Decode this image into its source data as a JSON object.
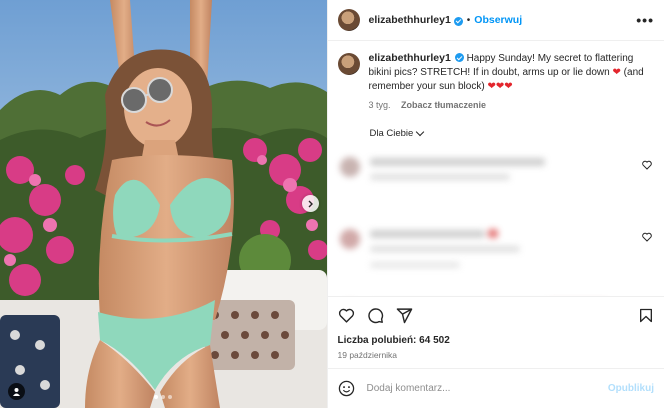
{
  "header": {
    "username": "elizabethhurley1",
    "separator": "•",
    "follow_label": "Obserwuj",
    "more_label": "•••"
  },
  "caption": {
    "username": "elizabethhurley1",
    "text": "Happy Sunday! My secret to flattering bikini pics? STRETCH! If in doubt, arms up or lie down",
    "text_tail": "(and remember your sun block)",
    "heart_single": "❤",
    "hearts": "❤❤❤",
    "age": "3 tyg.",
    "translate_label": "Zobacz tłumaczenie"
  },
  "comments_filter": {
    "label": "Dla Ciebie"
  },
  "engagement": {
    "likes_text": "Liczba polubień: 64 502",
    "date": "19 października"
  },
  "composer": {
    "placeholder": "Dodaj komentarz...",
    "post_label": "Opublikuj"
  },
  "carousel": {
    "slides": 3,
    "active_index": 0
  },
  "colors": {
    "accent": "#0095f6",
    "verified": "#1d9bf0",
    "heart": "#e3262d",
    "post_disabled": "#b2dffc"
  },
  "icons": [
    "more-icon",
    "verified-icon",
    "chevron-down-icon",
    "like-icon",
    "comment-icon",
    "share-icon",
    "bookmark-icon",
    "emoji-icon",
    "next-slide-icon",
    "user-tag-icon"
  ]
}
